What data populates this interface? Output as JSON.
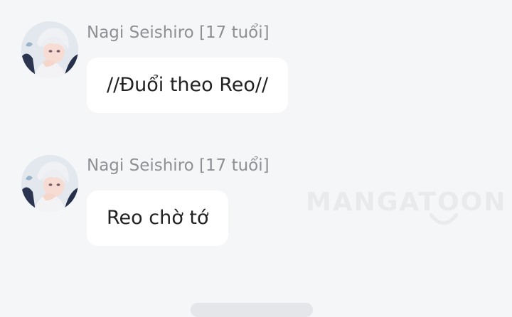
{
  "messages": [
    {
      "sender": "Nagi Seishiro [17 tuổi]",
      "text": "//Đuổi theo Reo//"
    },
    {
      "sender": "Nagi Seishiro [17 tuổi]",
      "text": "Reo chờ tớ"
    }
  ],
  "watermark": {
    "text": "MANGATOON"
  },
  "colors": {
    "background": "#f5f6f8",
    "bubble": "#ffffff",
    "sender": "#8e9093",
    "text": "#222222"
  }
}
